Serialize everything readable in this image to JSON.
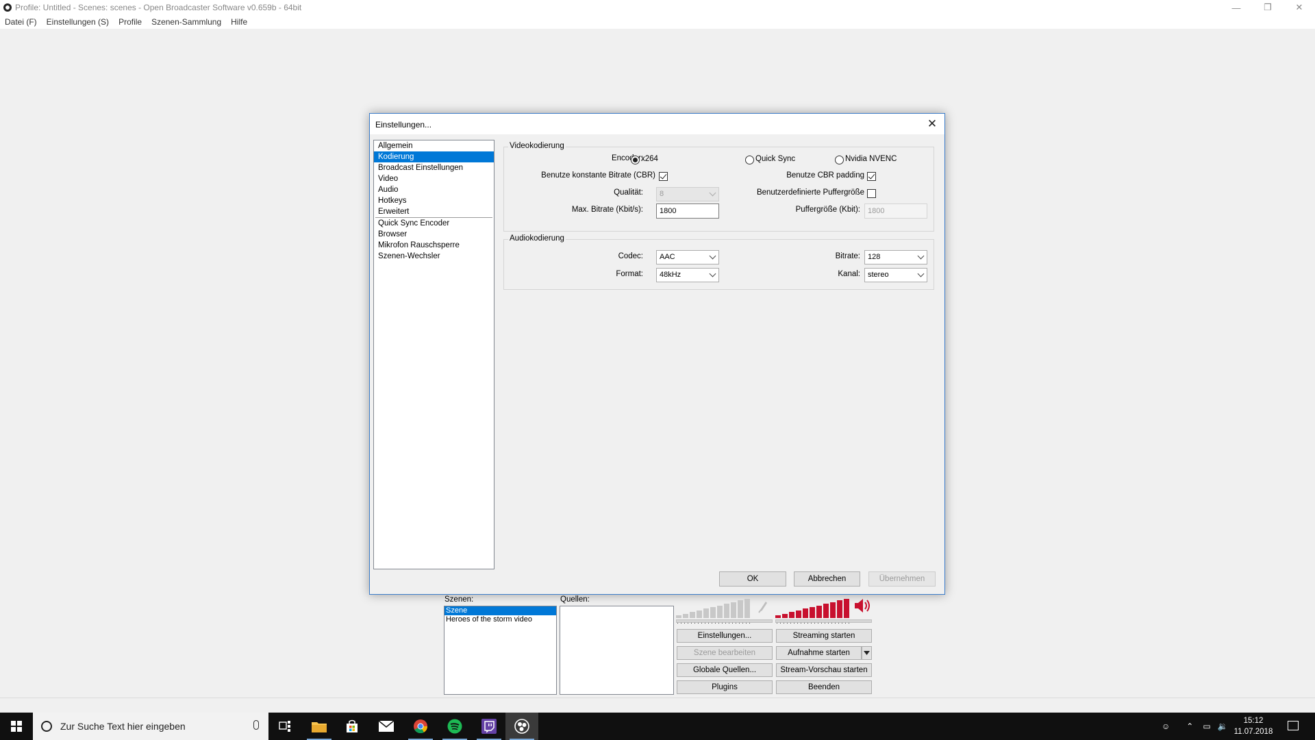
{
  "window": {
    "title": "Profile: Untitled - Scenes: scenes - Open Broadcaster Software v0.659b - 64bit",
    "minimize": "—",
    "restore": "❐",
    "close": "✕"
  },
  "menu": [
    "Datei (F)",
    "Einstellungen (S)",
    "Profile",
    "Szenen-Sammlung",
    "Hilfe"
  ],
  "dialog": {
    "title": "Einstellungen...",
    "nav_items": [
      "Allgemein",
      "Kodierung",
      "Broadcast Einstellungen",
      "Video",
      "Audio",
      "Hotkeys",
      "Erweitert"
    ],
    "nav_plugins": [
      "Quick Sync Encoder",
      "Browser",
      "Mikrofon Rauschsperre",
      "Szenen-Wechsler"
    ],
    "selected_nav": "Kodierung",
    "video": {
      "legend": "Videokodierung",
      "encoder_label": "Encoder:",
      "encoders": [
        "x264",
        "Quick Sync",
        "Nvidia NVENC"
      ],
      "selected_encoder": "x264",
      "cbr_label": "Benutze konstante Bitrate (CBR)",
      "cbr_checked": true,
      "cbr_padding_label": "Benutze CBR padding",
      "cbr_padding_checked": true,
      "quality_label": "Qualität:",
      "quality_value": "8",
      "custom_buffer_label": "Benutzerdefinierte Puffergröße",
      "custom_buffer_checked": false,
      "max_bitrate_label": "Max. Bitrate (Kbit/s):",
      "max_bitrate_value": "1800",
      "buffer_size_label": "Puffergröße (Kbit):",
      "buffer_size_value": "1800"
    },
    "audio": {
      "legend": "Audiokodierung",
      "codec_label": "Codec:",
      "codec_value": "AAC",
      "bitrate_label": "Bitrate:",
      "bitrate_value": "128",
      "format_label": "Format:",
      "format_value": "48kHz",
      "channel_label": "Kanal:",
      "channel_value": "stereo"
    },
    "buttons": {
      "ok": "OK",
      "cancel": "Abbrechen",
      "apply": "Übernehmen"
    }
  },
  "main": {
    "scenes_label": "Szenen:",
    "scenes": [
      "Szene",
      "Heroes of the storm video"
    ],
    "selected_scene": "Szene",
    "sources_label": "Quellen:",
    "buttons": {
      "settings": "Einstellungen...",
      "start_streaming": "Streaming starten",
      "edit_scene": "Szene bearbeiten",
      "start_recording": "Aufnahme starten",
      "global_sources": "Globale Quellen...",
      "start_preview": "Stream-Vorschau starten",
      "plugins": "Plugins",
      "exit": "Beenden"
    },
    "mic_level": 0,
    "desktop_level": 1.0
  },
  "taskbar": {
    "search_placeholder": "Zur Suche Text hier eingeben",
    "apps": [
      "task-view",
      "file-explorer",
      "store",
      "mail",
      "chrome",
      "spotify",
      "twitch",
      "obs"
    ],
    "active_app": "obs",
    "time": "15:12",
    "date": "11.07.2018"
  },
  "colors": {
    "accent": "#0078d7",
    "meter_red": "#c8102e",
    "meter_grey": "#c8c8c8"
  }
}
